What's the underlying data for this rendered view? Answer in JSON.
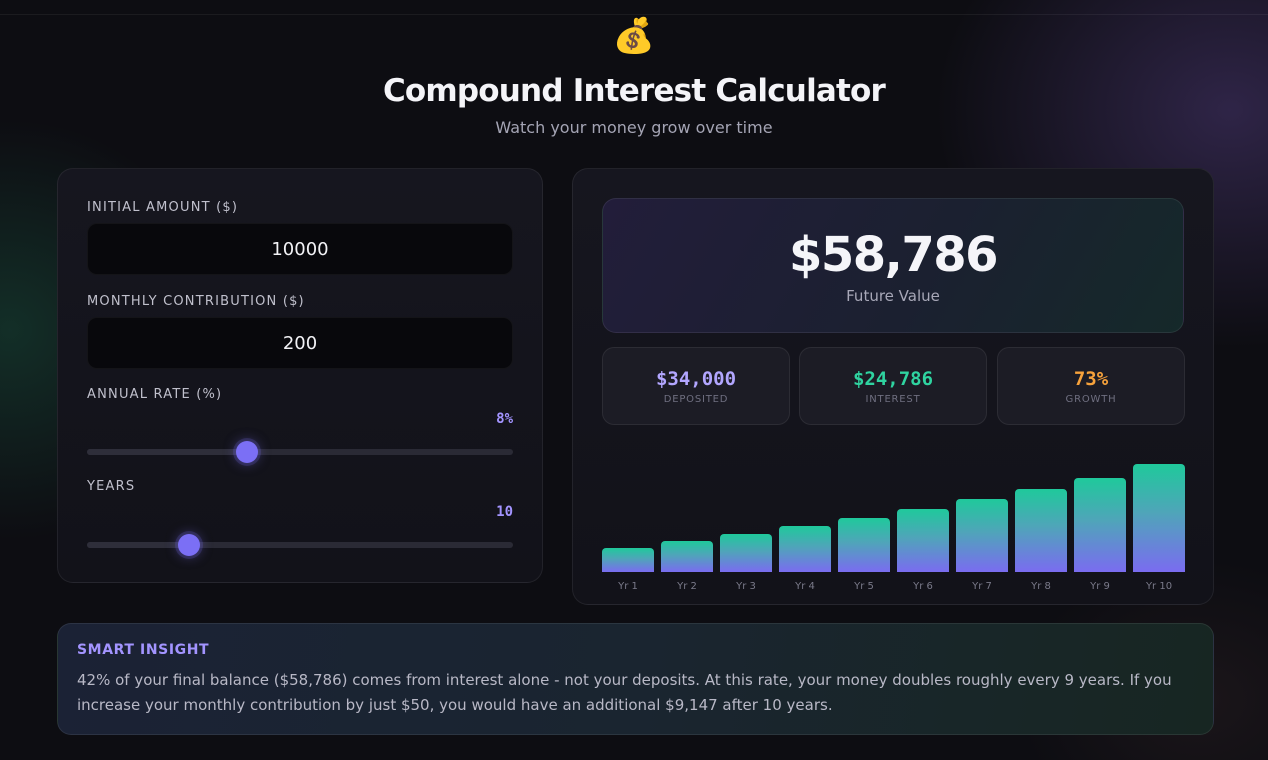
{
  "header": {
    "icon": "money-bag-icon",
    "emoji": "💰",
    "title": "Compound Interest Calculator",
    "subtitle": "Watch your money grow over time"
  },
  "inputs": {
    "initial_label": "INITIAL AMOUNT ($)",
    "initial_value": "10000",
    "monthly_label": "MONTHLY CONTRIBUTION ($)",
    "monthly_value": "200",
    "rate_label": "ANNUAL RATE (%)",
    "rate_display": "8%",
    "rate_value": 8,
    "rate_slider_fraction": 0.375,
    "years_label": "YEARS",
    "years_display": "10",
    "years_value": 10,
    "years_slider_fraction": 0.24
  },
  "results": {
    "future_value": "$58,786",
    "future_label": "Future Value",
    "deposited_value": "$34,000",
    "deposited_label": "DEPOSITED",
    "interest_value": "$24,786",
    "interest_label": "INTEREST",
    "growth_value": "73%",
    "growth_label": "GROWTH"
  },
  "colors": {
    "accent": "#7b6ff5",
    "deposited": "#b2a6ff",
    "interest": "#2fd3a0",
    "growth": "#f7a23b"
  },
  "chart_data": {
    "type": "bar",
    "categories": [
      "Yr 1",
      "Yr 2",
      "Yr 3",
      "Yr 4",
      "Yr 5",
      "Yr 6",
      "Yr 7",
      "Yr 8",
      "Yr 9",
      "Yr 10"
    ],
    "values": [
      13300,
      16900,
      20700,
      24900,
      29400,
      34200,
      39500,
      45200,
      51400,
      58786
    ],
    "ylim": [
      0,
      58786
    ]
  },
  "insight": {
    "title": "SMART INSIGHT",
    "text": "42% of your final balance ($58,786) comes from interest alone - not your deposits. At this rate, your money doubles roughly every 9 years. If you increase your monthly contribution by just $50, you would have an additional $9,147 after 10 years."
  }
}
